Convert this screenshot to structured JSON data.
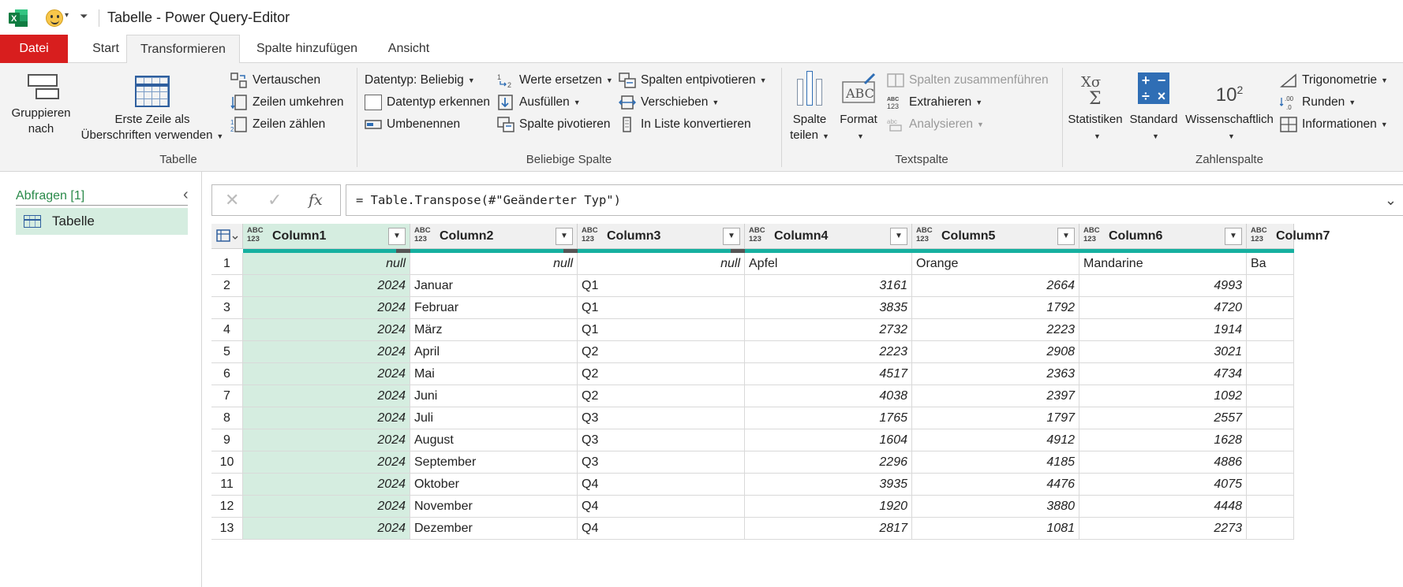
{
  "window": {
    "title": "Tabelle - Power Query-Editor",
    "app_icon": "excel-icon",
    "qa_icon": "smiley-icon"
  },
  "tabs": [
    {
      "label": "Datei"
    },
    {
      "label": "Start"
    },
    {
      "label": "Transformieren"
    },
    {
      "label": "Spalte hinzufügen"
    },
    {
      "label": "Ansicht"
    }
  ],
  "ribbon": {
    "tabelle": {
      "label": "Tabelle",
      "gruppieren": "Gruppieren nach",
      "gruppieren_l1": "Gruppieren",
      "gruppieren_l2": "nach",
      "erste_l1": "Erste Zeile als",
      "erste_l2": "Überschriften verwenden",
      "vertauschen": "Vertauschen",
      "umkehren": "Zeilen umkehren",
      "zaehlen": "Zeilen zählen"
    },
    "beliebig": {
      "label": "Beliebige Spalte",
      "datentyp": "Datentyp: Beliebig",
      "erkennen": "Datentyp erkennen",
      "umbenennen": "Umbenennen",
      "ersetzen": "Werte ersetzen",
      "ausfuellen": "Ausfüllen",
      "pivotieren": "Spalte pivotieren",
      "entpivotieren": "Spalten entpivotieren",
      "verschieben": "Verschieben",
      "liste": "In Liste konvertieren"
    },
    "text": {
      "label": "Textspalte",
      "teilen_l1": "Spalte",
      "teilen_l2": "teilen",
      "format": "Format",
      "zusammen": "Spalten zusammenführen",
      "extrahieren": "Extrahieren",
      "analysieren": "Analysieren"
    },
    "zahl": {
      "label": "Zahlenspalte",
      "statistiken": "Statistiken",
      "standard": "Standard",
      "wissenschaftlich": "Wissenschaftlich",
      "trig": "Trigonometrie",
      "runden": "Runden",
      "info": "Informationen"
    }
  },
  "queries": {
    "header": "Abfragen [1]",
    "items": [
      {
        "label": "Tabelle"
      }
    ]
  },
  "formula": {
    "text": "= Table.Transpose(#\"Geänderter Typ\")",
    "fx": "fx"
  },
  "table": {
    "type_label": "ABC\n123",
    "columns": [
      "Column1",
      "Column2",
      "Column3",
      "Column4",
      "Column5",
      "Column6",
      "Column7"
    ],
    "rows": [
      [
        "1",
        "null",
        "null",
        "null",
        "Apfel",
        "Orange",
        "Mandarine",
        "Ba"
      ],
      [
        "2",
        "2024",
        "Januar",
        "Q1",
        "3161",
        "2664",
        "4993",
        ""
      ],
      [
        "3",
        "2024",
        "Februar",
        "Q1",
        "3835",
        "1792",
        "4720",
        ""
      ],
      [
        "4",
        "2024",
        "März",
        "Q1",
        "2732",
        "2223",
        "1914",
        ""
      ],
      [
        "5",
        "2024",
        "April",
        "Q2",
        "2223",
        "2908",
        "3021",
        ""
      ],
      [
        "6",
        "2024",
        "Mai",
        "Q2",
        "4517",
        "2363",
        "4734",
        ""
      ],
      [
        "7",
        "2024",
        "Juni",
        "Q2",
        "4038",
        "2397",
        "1092",
        ""
      ],
      [
        "8",
        "2024",
        "Juli",
        "Q3",
        "1765",
        "1797",
        "2557",
        ""
      ],
      [
        "9",
        "2024",
        "August",
        "Q3",
        "1604",
        "4912",
        "1628",
        ""
      ],
      [
        "10",
        "2024",
        "September",
        "Q3",
        "2296",
        "4185",
        "4886",
        ""
      ],
      [
        "11",
        "2024",
        "Oktober",
        "Q4",
        "3935",
        "4476",
        "4075",
        ""
      ],
      [
        "12",
        "2024",
        "November",
        "Q4",
        "1920",
        "3880",
        "4448",
        ""
      ],
      [
        "13",
        "2024",
        "Dezember",
        "Q4",
        "2817",
        "1081",
        "2273",
        ""
      ]
    ]
  }
}
